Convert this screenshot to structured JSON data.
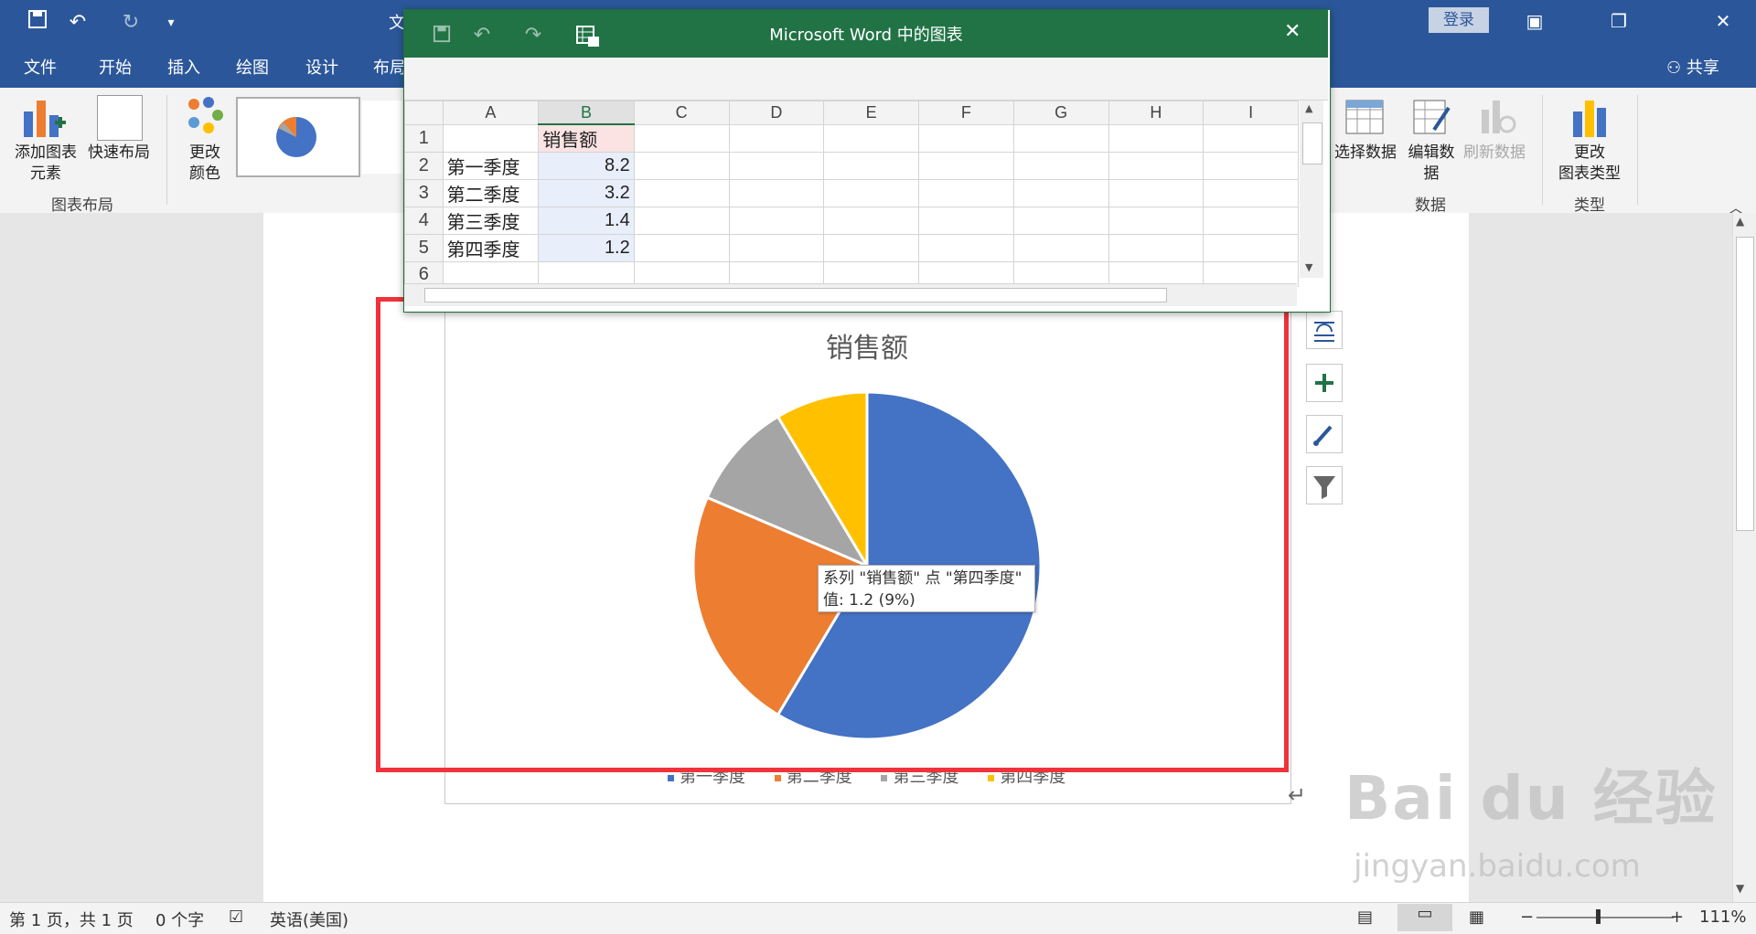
{
  "word": {
    "title_partial": "文",
    "login_label": "登录",
    "share_label": "共享",
    "tabs": [
      "文件",
      "开始",
      "插入",
      "绘图",
      "设计",
      "布局"
    ]
  },
  "ribbon": {
    "add_element_label": "添加图表\n元素",
    "quick_layout_label": "快速布局",
    "change_color_label": "更改\n颜色",
    "group_chart_layout": "图表布局",
    "select_data_label": "选择数据",
    "edit_data_label": "编辑数\n据",
    "refresh_data_label": "刷新数据",
    "group_data": "数据",
    "change_type_label": "更改\n图表类型",
    "group_type": "类型"
  },
  "excel": {
    "window_title": "Microsoft Word 中的图表",
    "columns": [
      "A",
      "B",
      "C",
      "D",
      "E",
      "F",
      "G",
      "H",
      "I"
    ],
    "rows": [
      {
        "num": "1",
        "a": "",
        "b": "销售额"
      },
      {
        "num": "2",
        "a": "第一季度",
        "b": "8.2"
      },
      {
        "num": "3",
        "a": "第二季度",
        "b": "3.2"
      },
      {
        "num": "4",
        "a": "第三季度",
        "b": "1.4"
      },
      {
        "num": "5",
        "a": "第四季度",
        "b": "1.2"
      },
      {
        "num": "6",
        "a": "",
        "b": ""
      }
    ]
  },
  "chart_data": {
    "type": "pie",
    "title": "销售额",
    "categories": [
      "第一季度",
      "第二季度",
      "第三季度",
      "第四季度"
    ],
    "values": [
      8.2,
      3.2,
      1.4,
      1.2
    ],
    "colors": [
      "#4472c4",
      "#ed7d31",
      "#a5a5a5",
      "#ffc000"
    ],
    "legend": "bottom"
  },
  "tooltip": {
    "line1": "系列 \"销售额\" 点 \"第四季度\"",
    "line2": "值: 1.2 (9%)"
  },
  "status": {
    "page": "第 1 页，共 1 页",
    "words": "0 个字",
    "language": "英语(美国)",
    "zoom": "111%"
  },
  "watermark": {
    "brand": "Bai du 经验",
    "url": "jingyan.baidu.com"
  }
}
